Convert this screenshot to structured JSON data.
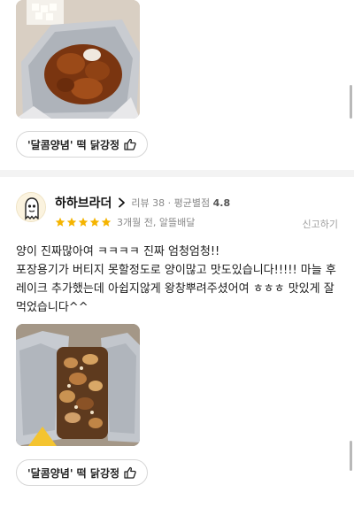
{
  "top_photo": {
    "alt": "은박 포장 안의 닭강정 사진"
  },
  "top_tag": {
    "label": "'달콤양념' 떡 닭강정"
  },
  "review": {
    "reviewer_name": "하하브라더",
    "review_count_label": "리뷰 38",
    "avg_rating_label": "평균별점",
    "avg_rating_value": "4.8",
    "stars": 5,
    "star_color": "#f5b400",
    "date_label": "3개월 전, 알뜰배달",
    "report_label": "신고하기",
    "text_line1": "양이 진짜많아여 ㅋㅋㅋㅋ 진짜 엄청엄청!!",
    "text_line2": "포장용기가 버티지 못할정도로 양이많고 맛도있습니다!!!!! 마늘 후레이크 추가했는데 아쉽지않게 왕창뿌려주셨어여 ㅎㅎㅎ 맛있게 잘먹었습니다^^"
  },
  "bottom_photo": {
    "alt": "마늘 후레이크가 올라간 닭강정 사진"
  },
  "bottom_tag": {
    "label": "'달콤양념' 떡 닭강정"
  }
}
